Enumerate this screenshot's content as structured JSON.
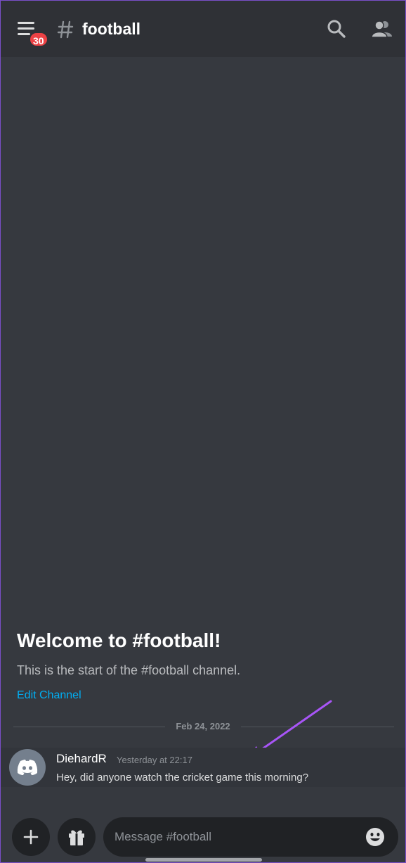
{
  "header": {
    "badge_count": "30",
    "channel_name": "football"
  },
  "welcome": {
    "title": "Welcome to #football!",
    "subtitle": "This is the start of the #football channel.",
    "edit_channel_label": "Edit Channel"
  },
  "divider": {
    "date": "Feb 24, 2022"
  },
  "message": {
    "author": "DiehardR",
    "timestamp": "Yesterday at 22:17",
    "text": "Hey, did anyone watch the cricket game this morning?"
  },
  "composer": {
    "placeholder": "Message #football",
    "value": ""
  },
  "colors": {
    "background": "#36393f",
    "header": "#2f3136",
    "badge": "#ed4245",
    "link": "#00aff4",
    "arrow": "#a855f7"
  },
  "icons": {
    "menu": "hamburger-icon",
    "channel": "hashtag-icon",
    "search": "search-icon",
    "members": "members-icon",
    "avatar": "discord-logo-icon",
    "plus": "plus-icon",
    "gift": "gift-icon",
    "emoji": "emoji-icon"
  }
}
